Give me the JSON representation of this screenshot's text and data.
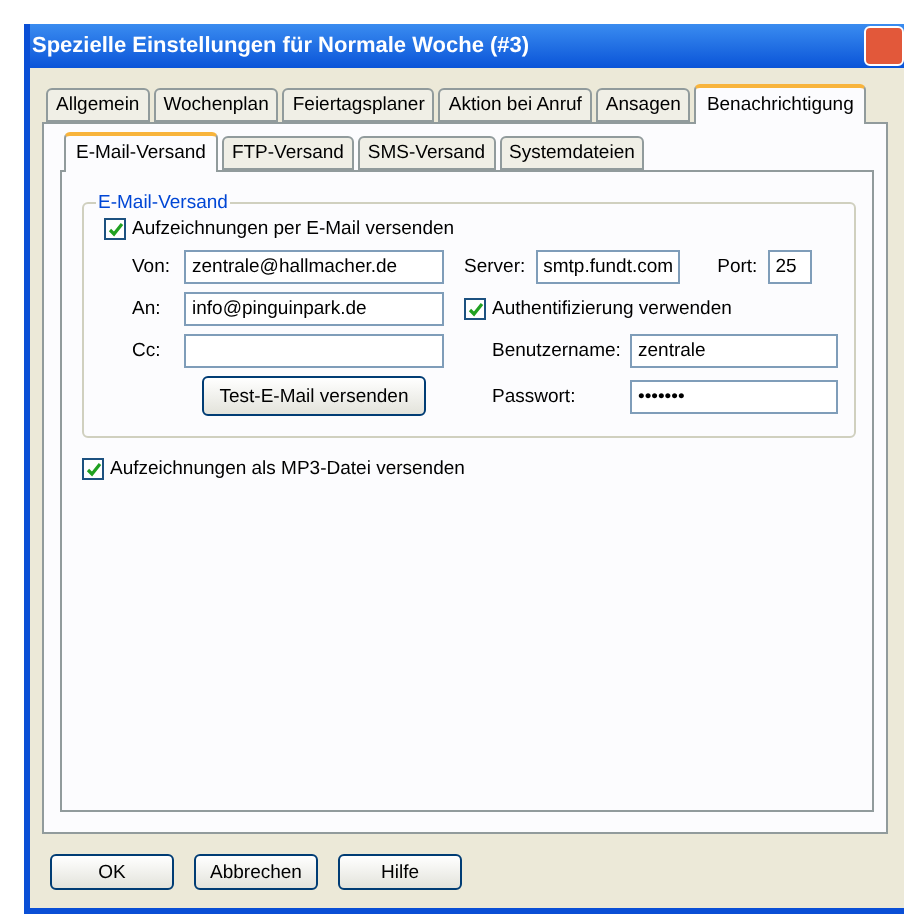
{
  "window": {
    "title": "Spezielle Einstellungen für Normale Woche (#3)"
  },
  "tabs": [
    {
      "label": "Allgemein",
      "selected": false
    },
    {
      "label": "Wochenplan",
      "selected": false
    },
    {
      "label": "Feiertagsplaner",
      "selected": false
    },
    {
      "label": "Aktion bei Anruf",
      "selected": false
    },
    {
      "label": "Ansagen",
      "selected": false
    },
    {
      "label": "Benachrichtigung",
      "selected": true
    }
  ],
  "subtabs": [
    {
      "label": "E-Mail-Versand",
      "selected": true
    },
    {
      "label": "FTP-Versand",
      "selected": false
    },
    {
      "label": "SMS-Versand",
      "selected": false
    },
    {
      "label": "Systemdateien",
      "selected": false
    }
  ],
  "group": {
    "title": "E-Mail-Versand",
    "send_checkbox": {
      "label": "Aufzeichnungen per E-Mail versenden",
      "checked": true
    },
    "from": {
      "label": "Von:",
      "value": "zentrale@hallmacher.de"
    },
    "to": {
      "label": "An:",
      "value": "info@pinguinpark.de"
    },
    "cc": {
      "label": "Cc:"
    },
    "test_button": "Test-E-Mail versenden",
    "server": {
      "label": "Server:",
      "value": "smtp.fundt.com"
    },
    "port": {
      "label": "Port:",
      "value": "25"
    },
    "auth_checkbox": {
      "label": "Authentifizierung verwenden",
      "checked": true
    },
    "username": {
      "label": "Benutzername:",
      "value": "zentrale"
    },
    "password": {
      "label": "Passwort:",
      "value": "•••••••"
    }
  },
  "mp3_checkbox": {
    "label": "Aufzeichnungen als MP3-Datei versenden",
    "checked": true
  },
  "buttons": [
    "OK",
    "Abbrechen",
    "Hilfe"
  ]
}
